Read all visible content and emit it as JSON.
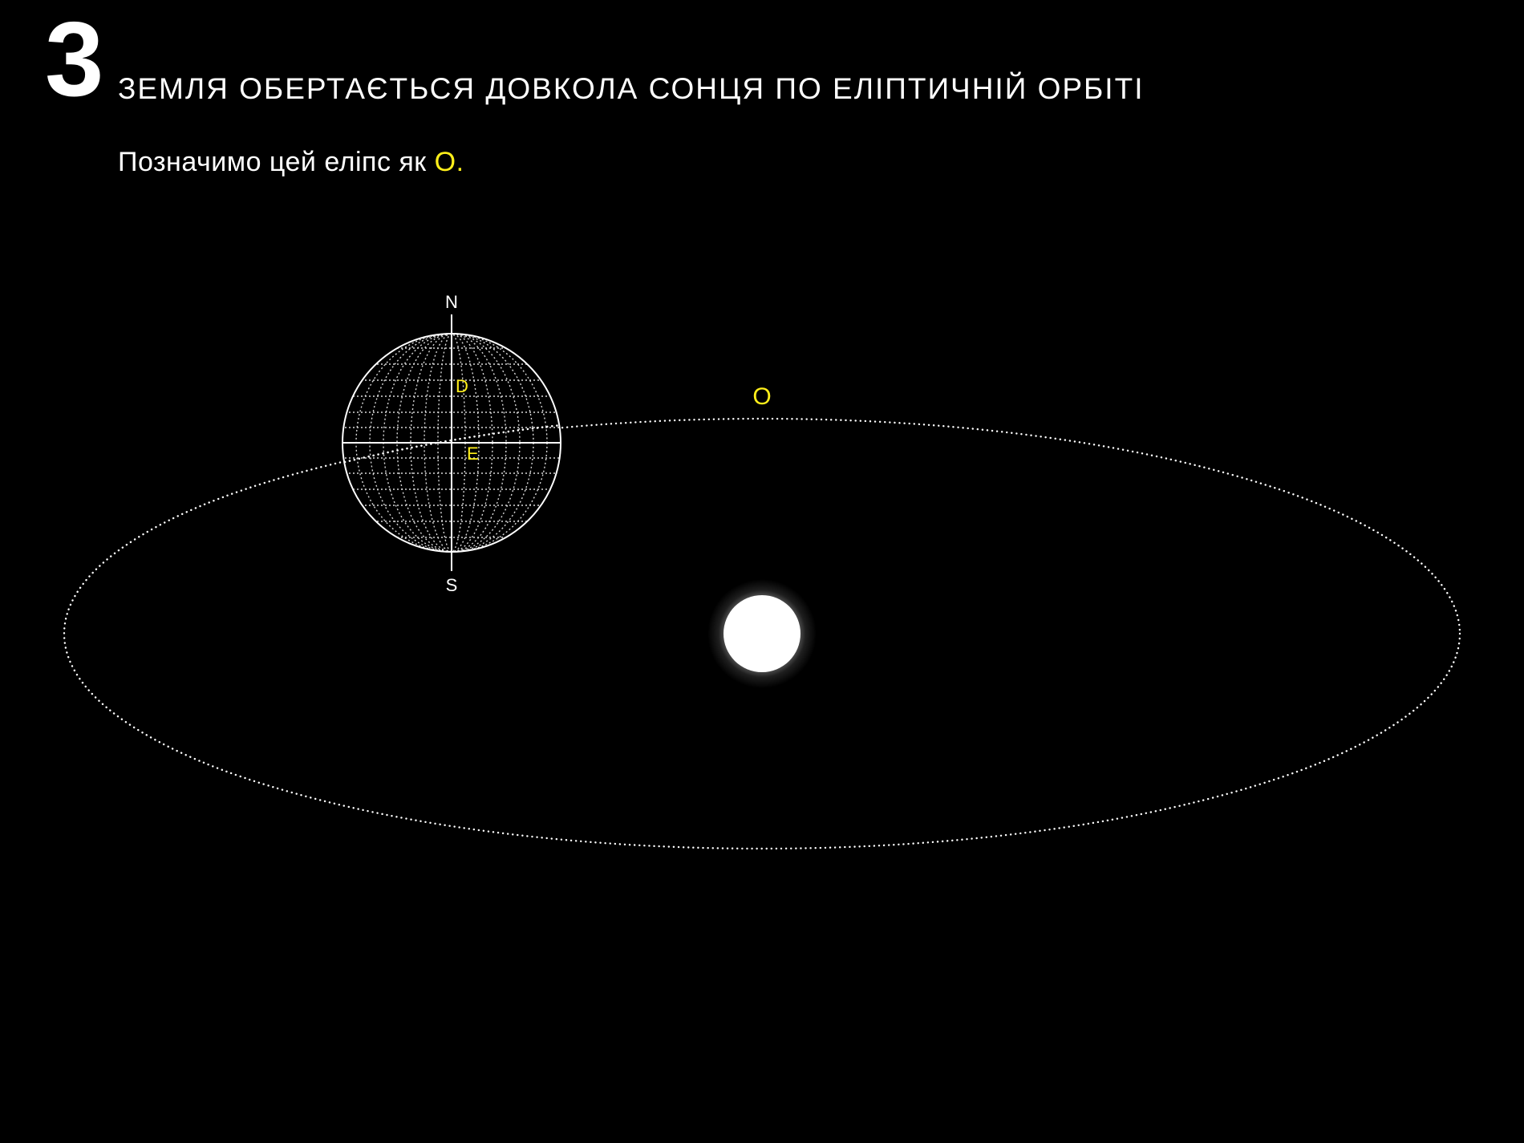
{
  "slide": {
    "number": "3",
    "title": "ЗЕМЛЯ ОБЕРТАЄТЬСЯ ДОВКОЛА СОНЦЯ ПО ЕЛІПТИЧНІЙ ОРБІТІ",
    "subtitle_text": "Позначимо цей еліпс як ",
    "subtitle_symbol": "O."
  },
  "diagram": {
    "orbit_label": "O",
    "north_label": "N",
    "south_label": "S",
    "axis_label": "D",
    "equator_label": "E"
  },
  "colors": {
    "background": "#000000",
    "foreground": "#ffffff",
    "accent": "#ffef1a"
  }
}
